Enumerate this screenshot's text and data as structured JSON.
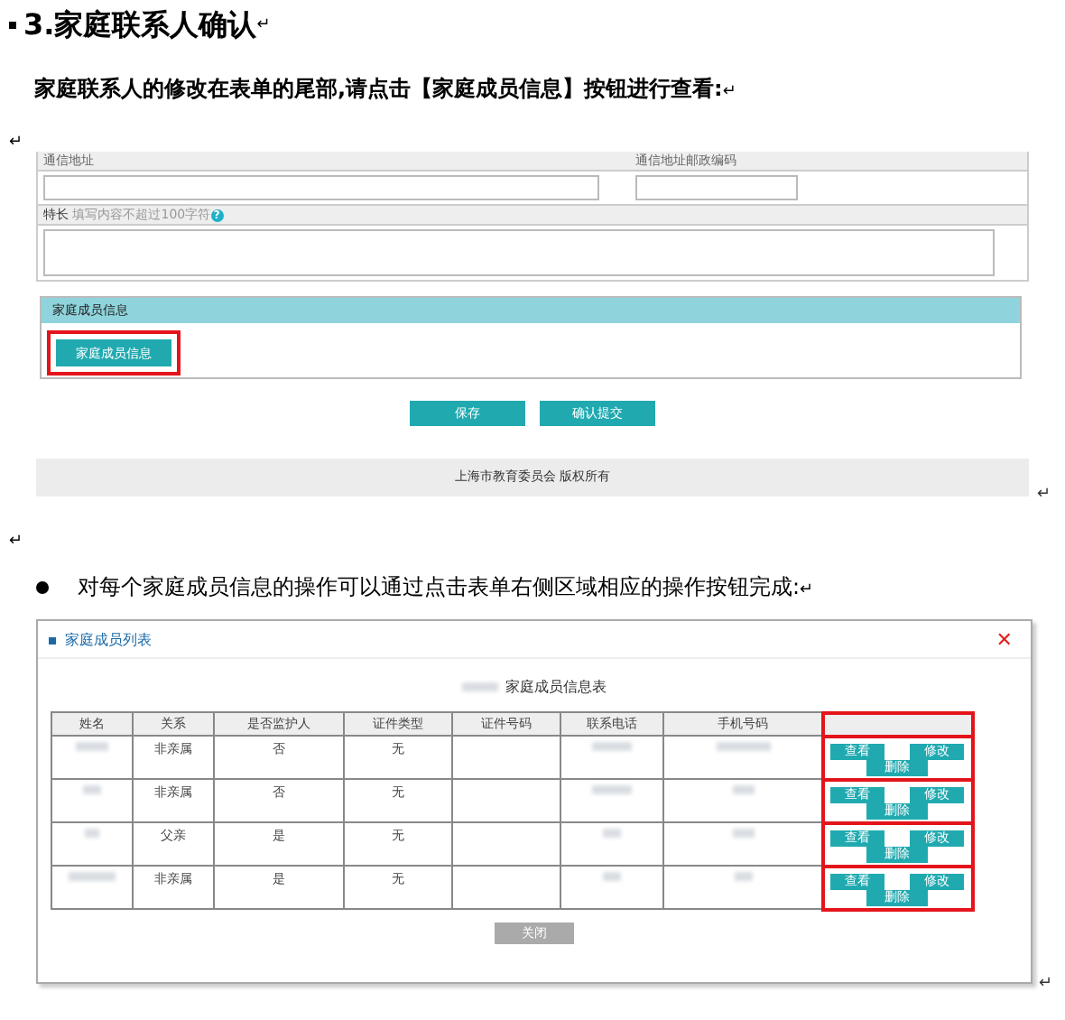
{
  "heading": {
    "number": "3.",
    "text": "家庭联系人确认",
    "mark": "↵"
  },
  "intro": {
    "text": "家庭联系人的修改在表单的尾部,请点击【家庭成员信息】按钮进行查看:",
    "mark": "↵"
  },
  "blank_mark": "↵",
  "form_shot": {
    "address_label": "通信地址",
    "postcode_label": "通信地址邮政编码",
    "specialty_label": "特长",
    "specialty_hint": "填写内容不超过100字符",
    "help": "?",
    "section_title": "家庭成员信息",
    "section_button": {
      "label": "家庭成员信息",
      "highlighted": true
    },
    "buttons": [
      "保存",
      "确认提交"
    ],
    "footer": "上海市教育委员会 版权所有",
    "mark": "↵"
  },
  "blank_mark_2": "↵",
  "bullet": {
    "text": "对每个家庭成员信息的操作可以通过点击表单右侧区域相应的操作按钮完成:",
    "mark": "↵"
  },
  "dialog": {
    "title": "家庭成员列表",
    "close": "✕",
    "caption": "家庭成员信息表",
    "columns": [
      "姓名",
      "关系",
      "是否监护人",
      "证件类型",
      "证件号码",
      "联系电话",
      "手机号码"
    ],
    "rows": [
      {
        "relation": "非亲属",
        "guardian": "否",
        "id_type": "无",
        "actions": [
          "查看",
          "修改",
          "删除"
        ]
      },
      {
        "relation": "非亲属",
        "guardian": "否",
        "id_type": "无",
        "actions": [
          "查看",
          "修改",
          "删除"
        ]
      },
      {
        "relation": "父亲",
        "guardian": "是",
        "id_type": "无",
        "actions": [
          "查看",
          "修改",
          "删除"
        ]
      },
      {
        "relation": "非亲属",
        "guardian": "是",
        "id_type": "无",
        "actions": [
          "查看",
          "修改",
          "删除"
        ]
      }
    ],
    "actions_highlighted": true,
    "close_button": "关闭",
    "mark": "↵"
  }
}
